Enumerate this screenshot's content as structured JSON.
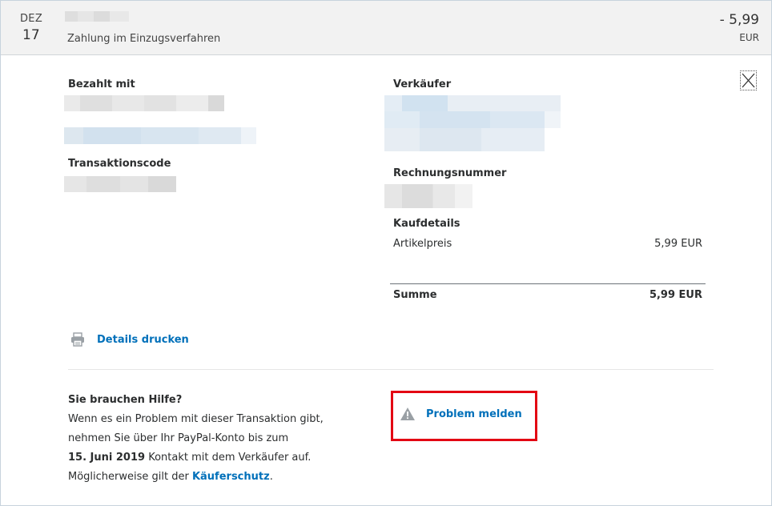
{
  "header": {
    "month": "DEZ",
    "day": "17",
    "subtitle": "Zahlung im Einzugsverfahren",
    "amount": "- 5,99",
    "currency": "EUR"
  },
  "left": {
    "paid_with_label": "Bezahlt mit",
    "transaction_code_label": "Transaktionscode",
    "print_label": "Details drucken"
  },
  "right": {
    "seller_label": "Verkäufer",
    "invoice_label": "Rechnungsnummer",
    "purchase_details_label": "Kaufdetails",
    "item_price_label": "Artikelpreis",
    "item_price_value": "5,99 EUR",
    "total_label": "Summe",
    "total_value": "5,99 EUR"
  },
  "help": {
    "title": "Sie brauchen Hilfe?",
    "line1": "Wenn es ein Problem mit dieser Transaktion gibt,",
    "line2": "nehmen Sie über Ihr PayPal-Konto bis zum",
    "deadline": "15. Juni 2019",
    "line3": " Kontakt mit dem Verkäufer auf.",
    "line4": "Möglicherweise gilt der ",
    "protection_link": "Käuferschutz",
    "line4_end": "."
  },
  "problem": {
    "label": "Problem melden"
  },
  "icons": {
    "close": "close-icon",
    "print": "printer-icon",
    "warning": "warning-icon"
  },
  "colors": {
    "link": "#0070ba",
    "highlight": "#e30613",
    "header_bg": "#f2f2f2"
  }
}
